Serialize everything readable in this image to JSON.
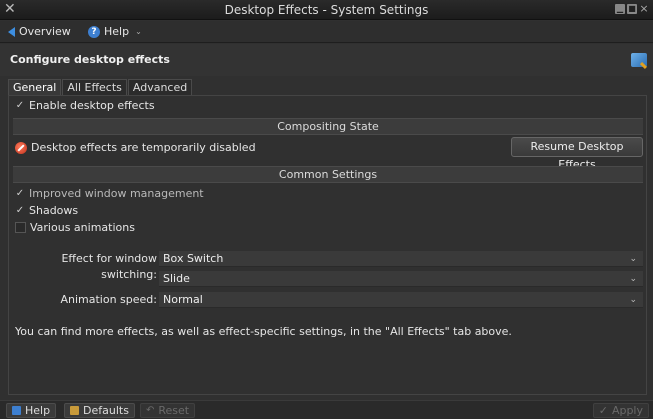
{
  "window": {
    "title": "Desktop Effects - System Settings"
  },
  "menubar": {
    "overview_label": "Overview",
    "help_label": "Help"
  },
  "header": {
    "title": "Configure desktop effects"
  },
  "tabs": [
    {
      "label": "General"
    },
    {
      "label": "All Effects"
    },
    {
      "label": "Advanced"
    }
  ],
  "general": {
    "enable_label": "Enable desktop effects",
    "compositing": {
      "heading": "Compositing State",
      "status_text": "Desktop effects are temporarily disabled",
      "resume_button": "Resume Desktop Effects"
    },
    "common": {
      "heading": "Common Settings",
      "improved_wm_label": "Improved window management",
      "shadows_label": "Shadows",
      "animations_label": "Various animations"
    },
    "switching": {
      "label": "Effect for window switching:",
      "value1": "Box Switch",
      "value2": "Slide"
    },
    "speed": {
      "label": "Animation speed:",
      "value": "Normal"
    },
    "info_text": "You can find more effects, as well as effect-specific settings, in the \"All Effects\" tab above."
  },
  "footer": {
    "help_label": "Help",
    "defaults_label": "Defaults",
    "reset_label": "Reset",
    "apply_label": "Apply"
  }
}
